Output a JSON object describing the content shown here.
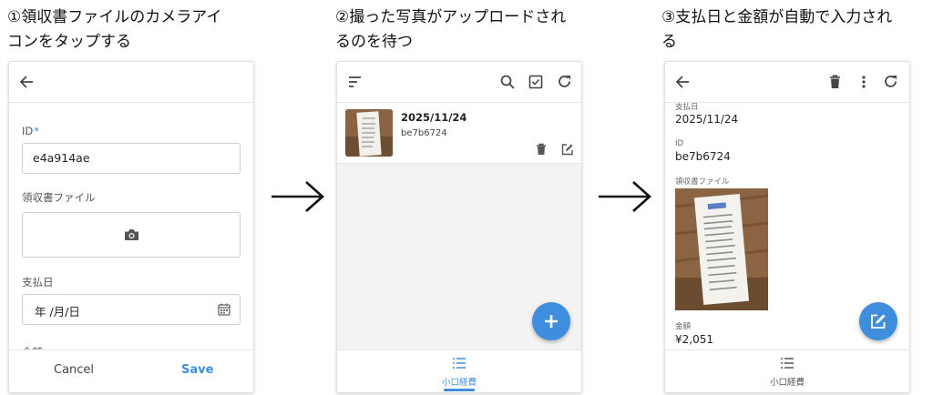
{
  "steps": [
    {
      "title_line1": "①領収書ファイルのカメラアイ",
      "title_line2": "コンをタップする"
    },
    {
      "title_line1": "②撮った写真がアップロードされ",
      "title_line2": "るのを待つ"
    },
    {
      "title_line1": "③支払日と金額が自動で入力され",
      "title_line2": "る"
    }
  ],
  "form": {
    "id_label": "ID",
    "id_required": "*",
    "id_value": "e4a914ae",
    "receipt_label": "領収書ファイル",
    "date_label": "支払日",
    "date_placeholder": "年 /月/日",
    "amount_label_partial": "金額",
    "cancel_label": "Cancel",
    "save_label": "Save"
  },
  "list": {
    "item_date": "2025/11/24",
    "item_id": "be7b6724",
    "nav_label": "小口経費"
  },
  "detail": {
    "date_label": "支払日",
    "date_value": "2025/11/24",
    "id_label": "ID",
    "id_value": "be7b6724",
    "receipt_label": "領収書ファイル",
    "amount_label": "金額",
    "amount_value": "¥2,051",
    "nav_label": "小口経費"
  },
  "colors": {
    "accent": "#3f8ede",
    "text": "#222222",
    "muted": "#555555",
    "list_background": "#f3f3f3"
  },
  "icons": [
    "arrow-left-icon",
    "camera-icon",
    "calendar-icon",
    "sort-icon",
    "search-icon",
    "checkbox-icon",
    "refresh-icon",
    "trash-icon",
    "edit-icon",
    "plus-icon",
    "more-vert-icon",
    "list-icon",
    "right-arrow-icon"
  ]
}
